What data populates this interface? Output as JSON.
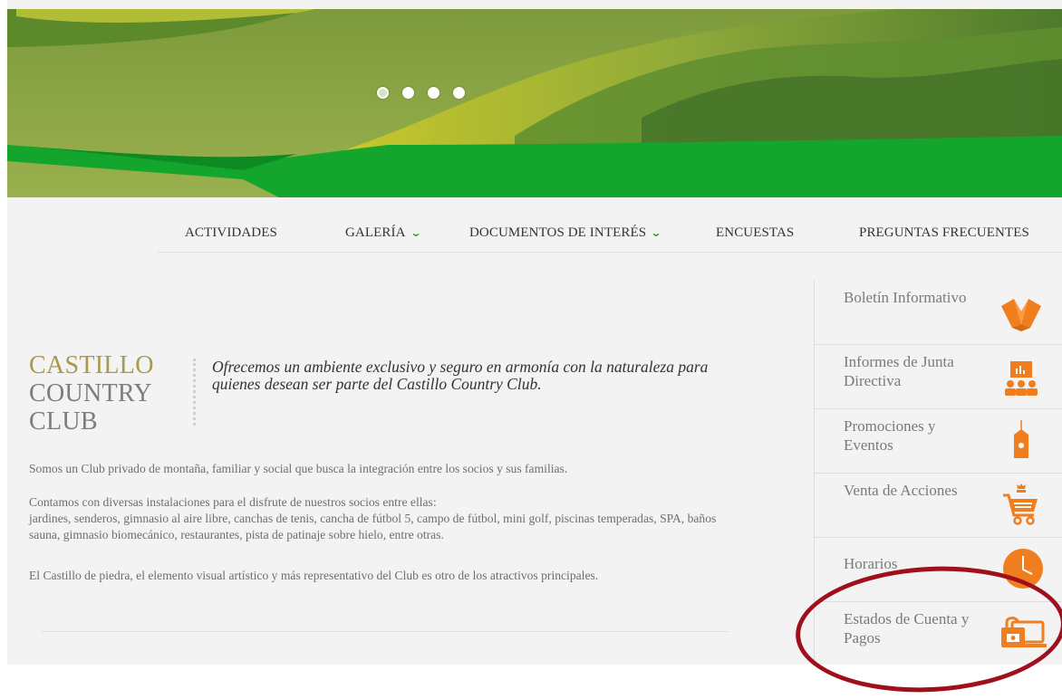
{
  "carousel": {
    "slides": [
      "slide-1",
      "slide-2",
      "slide-3",
      "slide-4"
    ],
    "active_index": 0
  },
  "nav": {
    "items": [
      {
        "label": "ACTIVIDADES",
        "has_dropdown": false
      },
      {
        "label": "GALERÍA",
        "has_dropdown": true
      },
      {
        "label": "DOCUMENTOS DE INTERÉS",
        "has_dropdown": true
      },
      {
        "label": "ENCUESTAS",
        "has_dropdown": false
      },
      {
        "label": "PREGUNTAS FRECUENTES",
        "has_dropdown": false
      }
    ],
    "dropdown_icon": "chevron-down-icon"
  },
  "club": {
    "title_line1": "CASTILLO",
    "title_line2": "COUNTRY",
    "title_line3": "CLUB",
    "tagline": "Ofrecemos un ambiente exclusivo y seguro en armonía con la naturaleza para quienes desean ser parte del Castillo Country Club.",
    "para1": "Somos un Club privado de montaña, familiar y social que busca la integración entre los socios y sus familias.",
    "para2_line1": "Contamos con diversas instalaciones para el disfrute de nuestros socios entre ellas:",
    "para2_line2": "jardines, senderos, gimnasio al aire libre, canchas de tenis, cancha de fútbol 5, campo de fútbol, mini golf, piscinas temperadas, SPA, baños sauna, gimnasio biomecánico, restaurantes, pista de patinaje sobre hielo, entre otras.",
    "para3": "El Castillo de piedra, el elemento visual artístico y más representativo del Club es otro de los atractivos principales."
  },
  "sidebar": {
    "items": [
      {
        "label": "Boletín Informativo",
        "icon": "open-book-icon"
      },
      {
        "label": "Informes de Junta Directiva",
        "icon": "board-meeting-icon"
      },
      {
        "label": "Promociones y Eventos",
        "icon": "price-tag-icon"
      },
      {
        "label": "Venta de Acciones",
        "icon": "shopping-cart-icon"
      },
      {
        "label": "Horarios",
        "icon": "clock-icon"
      },
      {
        "label": "Estados de Cuenta y Pagos",
        "icon": "payment-laptop-icon"
      }
    ]
  },
  "colors": {
    "accent_orange": "#f07d1e",
    "brand_green": "#1aa62a",
    "title_gold": "#a89a4a",
    "highlight_oval": "#a0101c"
  }
}
